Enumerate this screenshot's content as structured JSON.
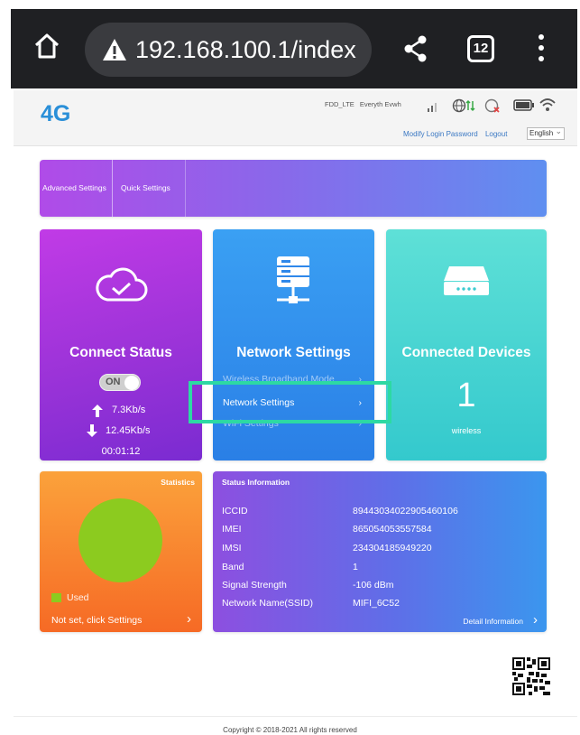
{
  "browser": {
    "url": "192.168.100.1/index",
    "tab_count": "12"
  },
  "header": {
    "brand": "4G",
    "network_mode": "FDD_LTE",
    "operator": "Everyth Evwh",
    "modify_password": "Modify Login Password",
    "logout": "Logout",
    "language": "English"
  },
  "nav": {
    "tabs": [
      "Advanced Settings",
      "Quick Settings"
    ]
  },
  "connect": {
    "title": "Connect Status",
    "toggle_label": "ON",
    "upload_rate": "7.3Kb/s",
    "download_rate": "12.45Kb/s",
    "duration": "00:01:12"
  },
  "network": {
    "title": "Network Settings",
    "menu": [
      "Wireless Broadband Mode",
      "Network Settings",
      "WiFi Settings"
    ]
  },
  "devices": {
    "title": "Connected Devices",
    "count": "1",
    "sub": "wireless"
  },
  "statistics": {
    "title": "Statistics",
    "legend": "Used",
    "link": "Not set, click Settings",
    "used_fraction": 1.0
  },
  "status_info": {
    "title": "Status Information",
    "rows": [
      {
        "k": "ICCID",
        "v": "89443034022905460106"
      },
      {
        "k": "IMEI",
        "v": "865054053557584"
      },
      {
        "k": "IMSI",
        "v": "234304185949220"
      },
      {
        "k": "Band",
        "v": "1"
      },
      {
        "k": "Signal Strength",
        "v": "-106 dBm"
      },
      {
        "k": "Network Name(SSID)",
        "v": "MIFI_6C52"
      }
    ],
    "detail_link": "Detail Information"
  },
  "footer": {
    "copyright": "Copyright © 2018-2021 All rights reserved"
  },
  "colors": {
    "highlight": "#2dd9a3",
    "pie": "#8ccb1f",
    "brand": "#2a8fd8"
  }
}
